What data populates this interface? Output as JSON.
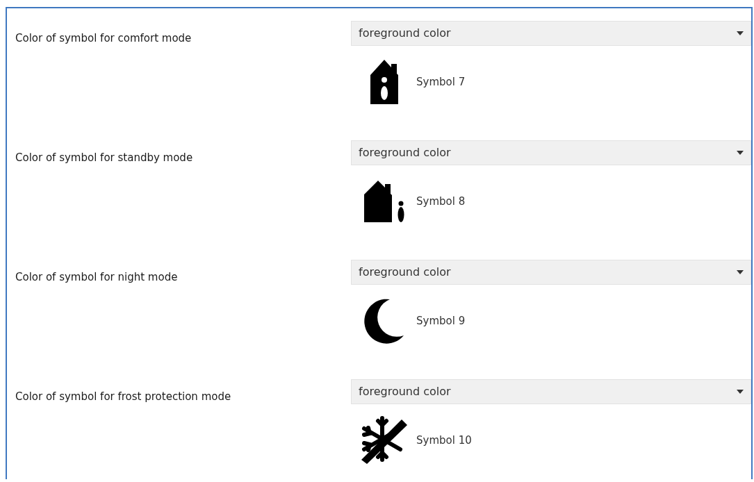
{
  "settings": [
    {
      "label": "Color of symbol for comfort mode",
      "value": "foreground color",
      "symbol": {
        "kind": "house-info",
        "text": "Symbol 7"
      }
    },
    {
      "label": "Color of symbol for standby mode",
      "value": "foreground color",
      "symbol": {
        "kind": "house-info-side",
        "text": "Symbol 8"
      }
    },
    {
      "label": "Color of symbol for night mode",
      "value": "foreground color",
      "symbol": {
        "kind": "moon",
        "text": "Symbol 9"
      }
    },
    {
      "label": "Color of symbol for frost protection mode",
      "value": "foreground color",
      "symbol": {
        "kind": "snowflake-crossed",
        "text": "Symbol 10"
      }
    }
  ]
}
